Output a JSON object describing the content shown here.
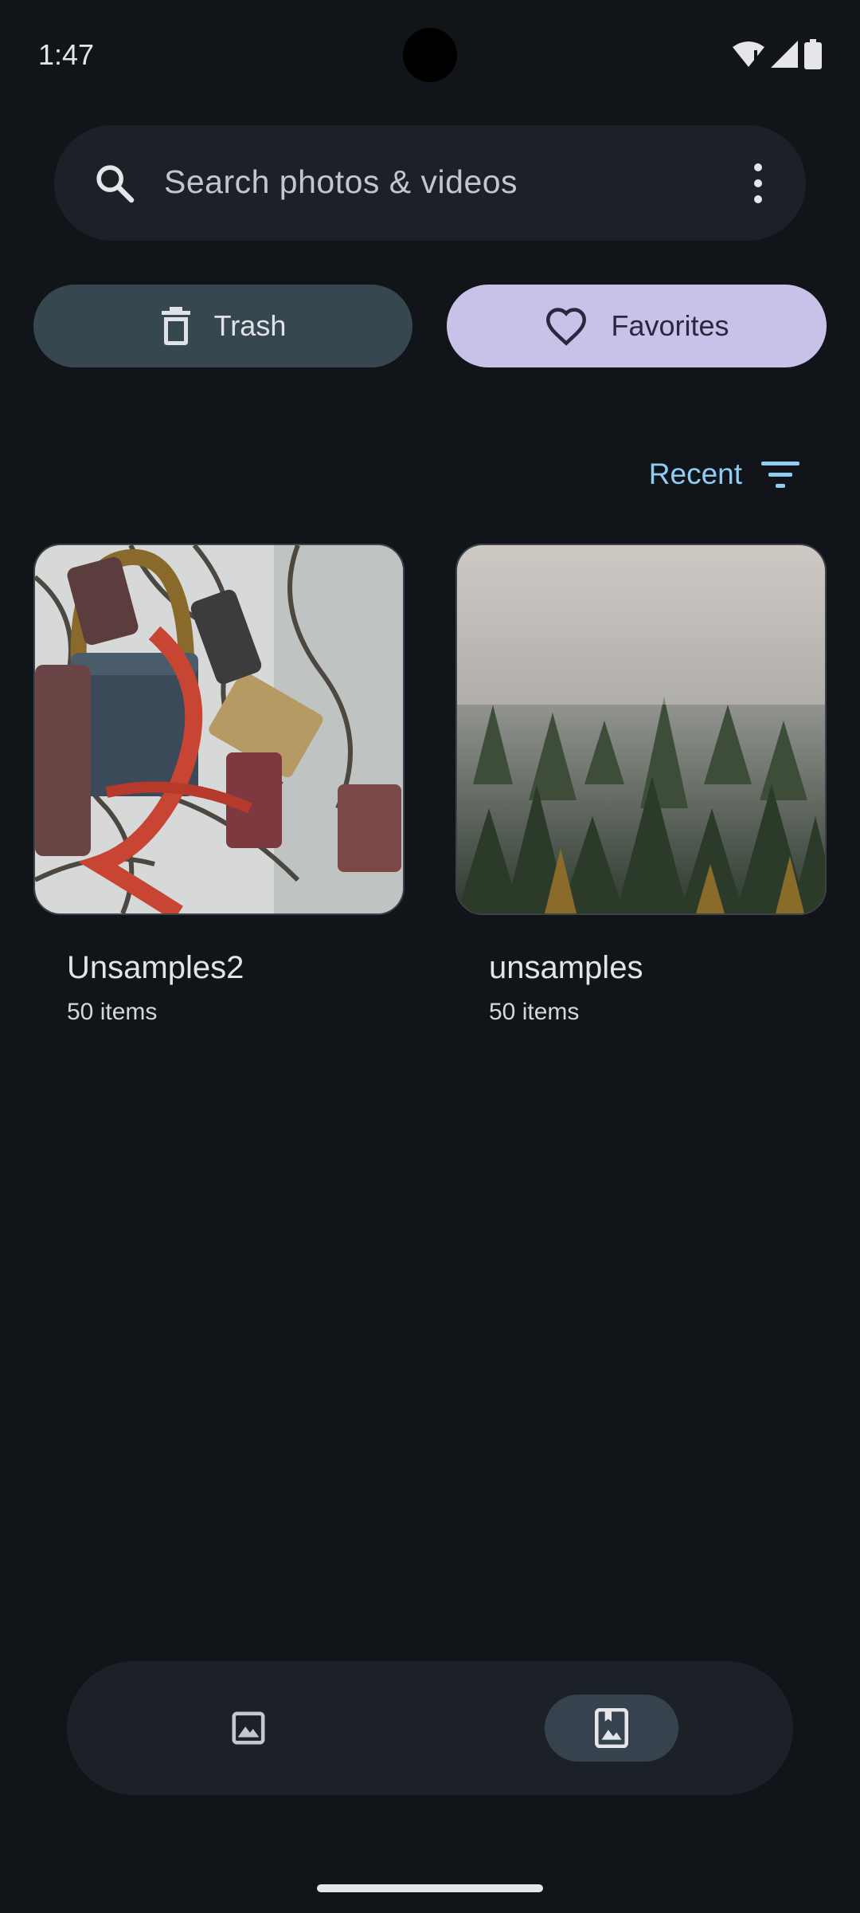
{
  "status_bar": {
    "time": "1:47"
  },
  "search": {
    "placeholder": "Search photos & videos"
  },
  "chips": {
    "trash_label": "Trash",
    "favorites_label": "Favorites"
  },
  "sort": {
    "label": "Recent"
  },
  "albums": [
    {
      "title": "Unsamples2",
      "count": "50 items"
    },
    {
      "title": "unsamples",
      "count": "50 items"
    }
  ],
  "colors": {
    "background": "#111418",
    "surface": "#1c2128",
    "trash_chip": "#37474f",
    "favorites_chip": "#c9c2e8",
    "accent": "#8fcdf5"
  },
  "icons": {
    "search": "search-icon",
    "more": "more-vert-icon",
    "trash": "trash-icon",
    "favorites": "heart-icon",
    "sort": "filter-list-icon",
    "nav_photos": "image-icon",
    "nav_albums": "photo-album-icon"
  }
}
